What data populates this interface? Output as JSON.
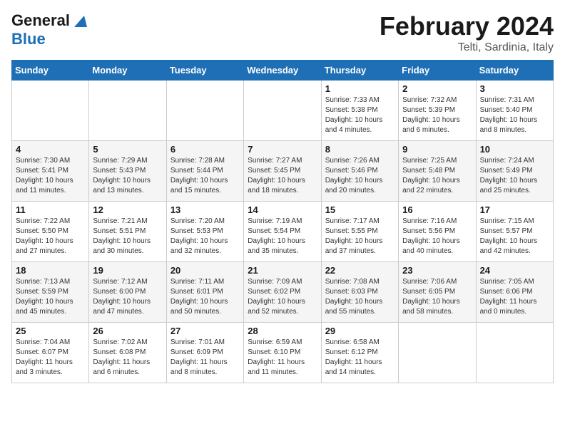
{
  "header": {
    "logo_general": "General",
    "logo_blue": "Blue",
    "title": "February 2024",
    "subtitle": "Telti, Sardinia, Italy"
  },
  "days_of_week": [
    "Sunday",
    "Monday",
    "Tuesday",
    "Wednesday",
    "Thursday",
    "Friday",
    "Saturday"
  ],
  "weeks": [
    [
      {
        "num": "",
        "info": ""
      },
      {
        "num": "",
        "info": ""
      },
      {
        "num": "",
        "info": ""
      },
      {
        "num": "",
        "info": ""
      },
      {
        "num": "1",
        "info": "Sunrise: 7:33 AM\nSunset: 5:38 PM\nDaylight: 10 hours\nand 4 minutes."
      },
      {
        "num": "2",
        "info": "Sunrise: 7:32 AM\nSunset: 5:39 PM\nDaylight: 10 hours\nand 6 minutes."
      },
      {
        "num": "3",
        "info": "Sunrise: 7:31 AM\nSunset: 5:40 PM\nDaylight: 10 hours\nand 8 minutes."
      }
    ],
    [
      {
        "num": "4",
        "info": "Sunrise: 7:30 AM\nSunset: 5:41 PM\nDaylight: 10 hours\nand 11 minutes."
      },
      {
        "num": "5",
        "info": "Sunrise: 7:29 AM\nSunset: 5:43 PM\nDaylight: 10 hours\nand 13 minutes."
      },
      {
        "num": "6",
        "info": "Sunrise: 7:28 AM\nSunset: 5:44 PM\nDaylight: 10 hours\nand 15 minutes."
      },
      {
        "num": "7",
        "info": "Sunrise: 7:27 AM\nSunset: 5:45 PM\nDaylight: 10 hours\nand 18 minutes."
      },
      {
        "num": "8",
        "info": "Sunrise: 7:26 AM\nSunset: 5:46 PM\nDaylight: 10 hours\nand 20 minutes."
      },
      {
        "num": "9",
        "info": "Sunrise: 7:25 AM\nSunset: 5:48 PM\nDaylight: 10 hours\nand 22 minutes."
      },
      {
        "num": "10",
        "info": "Sunrise: 7:24 AM\nSunset: 5:49 PM\nDaylight: 10 hours\nand 25 minutes."
      }
    ],
    [
      {
        "num": "11",
        "info": "Sunrise: 7:22 AM\nSunset: 5:50 PM\nDaylight: 10 hours\nand 27 minutes."
      },
      {
        "num": "12",
        "info": "Sunrise: 7:21 AM\nSunset: 5:51 PM\nDaylight: 10 hours\nand 30 minutes."
      },
      {
        "num": "13",
        "info": "Sunrise: 7:20 AM\nSunset: 5:53 PM\nDaylight: 10 hours\nand 32 minutes."
      },
      {
        "num": "14",
        "info": "Sunrise: 7:19 AM\nSunset: 5:54 PM\nDaylight: 10 hours\nand 35 minutes."
      },
      {
        "num": "15",
        "info": "Sunrise: 7:17 AM\nSunset: 5:55 PM\nDaylight: 10 hours\nand 37 minutes."
      },
      {
        "num": "16",
        "info": "Sunrise: 7:16 AM\nSunset: 5:56 PM\nDaylight: 10 hours\nand 40 minutes."
      },
      {
        "num": "17",
        "info": "Sunrise: 7:15 AM\nSunset: 5:57 PM\nDaylight: 10 hours\nand 42 minutes."
      }
    ],
    [
      {
        "num": "18",
        "info": "Sunrise: 7:13 AM\nSunset: 5:59 PM\nDaylight: 10 hours\nand 45 minutes."
      },
      {
        "num": "19",
        "info": "Sunrise: 7:12 AM\nSunset: 6:00 PM\nDaylight: 10 hours\nand 47 minutes."
      },
      {
        "num": "20",
        "info": "Sunrise: 7:11 AM\nSunset: 6:01 PM\nDaylight: 10 hours\nand 50 minutes."
      },
      {
        "num": "21",
        "info": "Sunrise: 7:09 AM\nSunset: 6:02 PM\nDaylight: 10 hours\nand 52 minutes."
      },
      {
        "num": "22",
        "info": "Sunrise: 7:08 AM\nSunset: 6:03 PM\nDaylight: 10 hours\nand 55 minutes."
      },
      {
        "num": "23",
        "info": "Sunrise: 7:06 AM\nSunset: 6:05 PM\nDaylight: 10 hours\nand 58 minutes."
      },
      {
        "num": "24",
        "info": "Sunrise: 7:05 AM\nSunset: 6:06 PM\nDaylight: 11 hours\nand 0 minutes."
      }
    ],
    [
      {
        "num": "25",
        "info": "Sunrise: 7:04 AM\nSunset: 6:07 PM\nDaylight: 11 hours\nand 3 minutes."
      },
      {
        "num": "26",
        "info": "Sunrise: 7:02 AM\nSunset: 6:08 PM\nDaylight: 11 hours\nand 6 minutes."
      },
      {
        "num": "27",
        "info": "Sunrise: 7:01 AM\nSunset: 6:09 PM\nDaylight: 11 hours\nand 8 minutes."
      },
      {
        "num": "28",
        "info": "Sunrise: 6:59 AM\nSunset: 6:10 PM\nDaylight: 11 hours\nand 11 minutes."
      },
      {
        "num": "29",
        "info": "Sunrise: 6:58 AM\nSunset: 6:12 PM\nDaylight: 11 hours\nand 14 minutes."
      },
      {
        "num": "",
        "info": ""
      },
      {
        "num": "",
        "info": ""
      }
    ]
  ]
}
